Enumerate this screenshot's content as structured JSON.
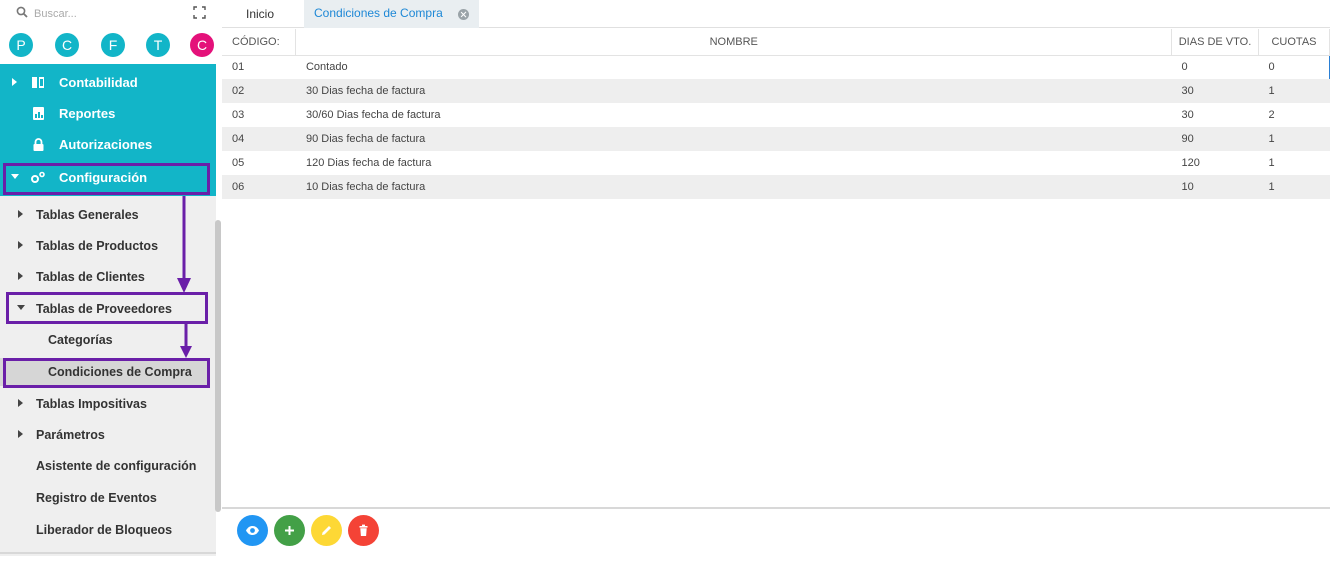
{
  "search": {
    "placeholder": "Buscar..."
  },
  "circles": [
    {
      "letter": "P",
      "color": "#12b5c8"
    },
    {
      "letter": "C",
      "color": "#12b5c8"
    },
    {
      "letter": "F",
      "color": "#12b5c8"
    },
    {
      "letter": "T",
      "color": "#12b5c8"
    },
    {
      "letter": "C",
      "color": "#e4117a"
    }
  ],
  "menu": {
    "contabilidad": "Contabilidad",
    "reportes": "Reportes",
    "autorizaciones": "Autorizaciones",
    "configuracion": "Configuración"
  },
  "submenu": {
    "tablas_generales": "Tablas Generales",
    "tablas_productos": "Tablas de Productos",
    "tablas_clientes": "Tablas de Clientes",
    "tablas_proveedores": "Tablas de Proveedores",
    "categorias": "Categorías",
    "condiciones_compra": "Condiciones de Compra",
    "tablas_impositivas": "Tablas Impositivas",
    "parametros": "Parámetros",
    "asistente": "Asistente de configuración",
    "registro_eventos": "Registro de Eventos",
    "liberador_bloqueos": "Liberador de Bloqueos"
  },
  "tabs": {
    "inicio": "Inicio",
    "active": "Condiciones de Compra"
  },
  "table": {
    "headers": {
      "codigo": "CÓDIGO:",
      "nombre": "NOMBRE",
      "dias": "DIAS DE VTO.",
      "cuotas": "CUOTAS"
    },
    "rows": [
      {
        "codigo": "01",
        "nombre": "Contado",
        "dias": "0",
        "cuotas": "0"
      },
      {
        "codigo": "02",
        "nombre": "30 Dias fecha de factura",
        "dias": "30",
        "cuotas": "1"
      },
      {
        "codigo": "03",
        "nombre": "30/60 Dias fecha de factura",
        "dias": "30",
        "cuotas": "2"
      },
      {
        "codigo": "04",
        "nombre": "90 Dias fecha de factura",
        "dias": "90",
        "cuotas": "1"
      },
      {
        "codigo": "05",
        "nombre": "120 Dias fecha de factura",
        "dias": "120",
        "cuotas": "1"
      },
      {
        "codigo": "06",
        "nombre": "10 Dias fecha de factura",
        "dias": "10",
        "cuotas": "1"
      }
    ]
  },
  "actions": [
    {
      "icon": "eye-icon",
      "color": "#2196f3"
    },
    {
      "icon": "plus-icon",
      "color": "#43a047"
    },
    {
      "icon": "pencil-icon",
      "color": "#fdd835"
    },
    {
      "icon": "trash-icon",
      "color": "#f44336"
    }
  ],
  "colors": {
    "teal": "#12b5c8",
    "highlight": "#6a1fa8",
    "tab_blue": "#1e88d6"
  }
}
